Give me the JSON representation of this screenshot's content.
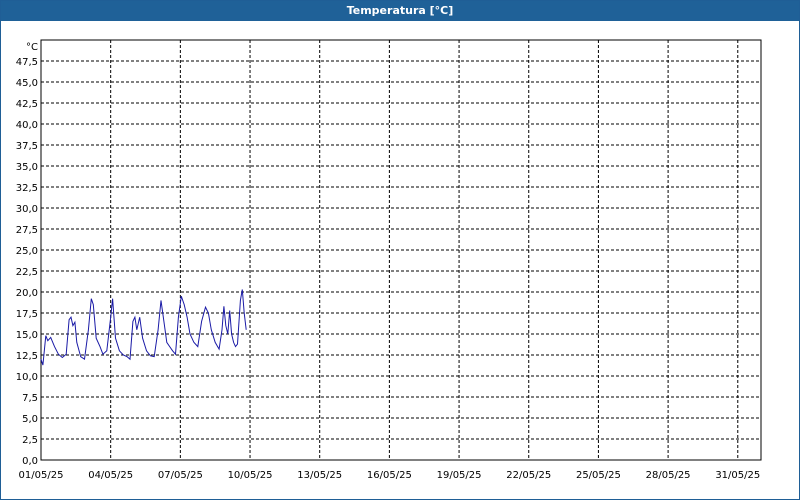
{
  "window": {
    "title": "Temperatura [°C]"
  },
  "colors": {
    "titlebar": "#1f6198",
    "line": "#1a1aa6",
    "grid": "#000000",
    "background": "#ffffff"
  },
  "chart_data": {
    "type": "line",
    "title": "Temperatura [°C]",
    "ylabel": "°C",
    "xlabel": "",
    "ylim": [
      0,
      50
    ],
    "yticks": [
      0,
      2.5,
      5,
      7.5,
      10,
      12.5,
      15,
      17.5,
      20,
      22.5,
      25,
      27.5,
      30,
      32.5,
      35,
      37.5,
      40,
      42.5,
      45,
      47.5
    ],
    "ytick_labels": [
      "0,0",
      "2,5",
      "5,0",
      "7,5",
      "10,0",
      "12,5",
      "15,0",
      "17,5",
      "20,0",
      "22,5",
      "25,0",
      "27,5",
      "30,0",
      "32,5",
      "35,0",
      "37,5",
      "40,0",
      "42,5",
      "45,0",
      "47,5"
    ],
    "xlim": [
      "01/05/25",
      "01/06/25"
    ],
    "xtick_labels": [
      "01/05/25",
      "04/05/25",
      "07/05/25",
      "10/05/25",
      "13/05/25",
      "16/05/25",
      "19/05/25",
      "22/05/25",
      "25/05/25",
      "28/05/25",
      "31/05/25"
    ],
    "grid": true,
    "series": [
      {
        "values": [
          [
            "01/05/25 00:00",
            12.0
          ],
          [
            "01/05/25 02:00",
            11.3
          ],
          [
            "01/05/25 05:00",
            14.8
          ],
          [
            "01/05/25 07:00",
            14.2
          ],
          [
            "01/05/25 10:00",
            14.6
          ],
          [
            "01/05/25 14:00",
            13.5
          ],
          [
            "01/05/25 18:00",
            12.6
          ],
          [
            "01/05/25 22:00",
            12.2
          ],
          [
            "02/05/25 02:00",
            12.6
          ],
          [
            "02/05/25 05:00",
            16.7
          ],
          [
            "02/05/25 07:00",
            17.0
          ],
          [
            "02/05/25 09:00",
            16.0
          ],
          [
            "02/05/25 11:00",
            16.4
          ],
          [
            "02/05/25 13:00",
            14.0
          ],
          [
            "02/05/25 17:00",
            12.3
          ],
          [
            "02/05/25 21:00",
            12.0
          ],
          [
            "03/05/25 01:00",
            15.5
          ],
          [
            "03/05/25 04:00",
            19.2
          ],
          [
            "03/05/25 06:00",
            18.5
          ],
          [
            "03/05/25 09:00",
            14.5
          ],
          [
            "03/05/25 13:00",
            13.5
          ],
          [
            "03/05/25 16:00",
            12.6
          ],
          [
            "03/05/25 20:00",
            13.0
          ],
          [
            "04/05/25 00:00",
            17.0
          ],
          [
            "04/05/25 02:00",
            19.2
          ],
          [
            "04/05/25 05:00",
            14.5
          ],
          [
            "04/05/25 09:00",
            13.0
          ],
          [
            "04/05/25 13:00",
            12.5
          ],
          [
            "04/05/25 17:00",
            12.3
          ],
          [
            "04/05/25 20:00",
            12.0
          ],
          [
            "04/05/25 23:00",
            16.5
          ],
          [
            "05/05/25 01:00",
            17.0
          ],
          [
            "05/05/25 03:00",
            15.5
          ],
          [
            "05/05/25 06:00",
            17.0
          ],
          [
            "05/05/25 09:00",
            14.5
          ],
          [
            "05/05/25 13:00",
            13.0
          ],
          [
            "05/05/25 17:00",
            12.4
          ],
          [
            "05/05/25 21:00",
            12.3
          ],
          [
            "06/05/25 01:00",
            15.5
          ],
          [
            "06/05/25 04:00",
            19.0
          ],
          [
            "06/05/25 07:00",
            16.5
          ],
          [
            "06/05/25 10:00",
            14.0
          ],
          [
            "06/05/25 13:00",
            13.5
          ],
          [
            "06/05/25 16:00",
            13.0
          ],
          [
            "06/05/25 19:00",
            12.6
          ],
          [
            "06/05/25 22:00",
            17.0
          ],
          [
            "07/05/25 01:00",
            19.5
          ],
          [
            "07/05/25 04:00",
            18.5
          ],
          [
            "07/05/25 07:00",
            17.0
          ],
          [
            "07/05/25 10:00",
            15.0
          ],
          [
            "07/05/25 14:00",
            14.0
          ],
          [
            "07/05/25 18:00",
            13.5
          ],
          [
            "07/05/25 22:00",
            16.5
          ],
          [
            "08/05/25 02:00",
            18.2
          ],
          [
            "08/05/25 05:00",
            17.5
          ],
          [
            "08/05/25 08:00",
            15.5
          ],
          [
            "08/05/25 12:00",
            14.0
          ],
          [
            "08/05/25 16:00",
            13.2
          ],
          [
            "08/05/25 19:00",
            15.5
          ],
          [
            "08/05/25 21:00",
            18.3
          ],
          [
            "08/05/25 23:00",
            16.0
          ],
          [
            "09/05/25 01:00",
            15.0
          ],
          [
            "09/05/25 03:00",
            17.8
          ],
          [
            "09/05/25 05:00",
            15.0
          ],
          [
            "09/05/25 07:00",
            14.0
          ],
          [
            "09/05/25 09:00",
            13.5
          ],
          [
            "09/05/25 11:00",
            13.8
          ],
          [
            "09/05/25 14:00",
            19.0
          ],
          [
            "09/05/25 16:00",
            20.3
          ],
          [
            "09/05/25 18:00",
            17.5
          ],
          [
            "09/05/25 20:00",
            15.5
          ]
        ]
      }
    ]
  }
}
